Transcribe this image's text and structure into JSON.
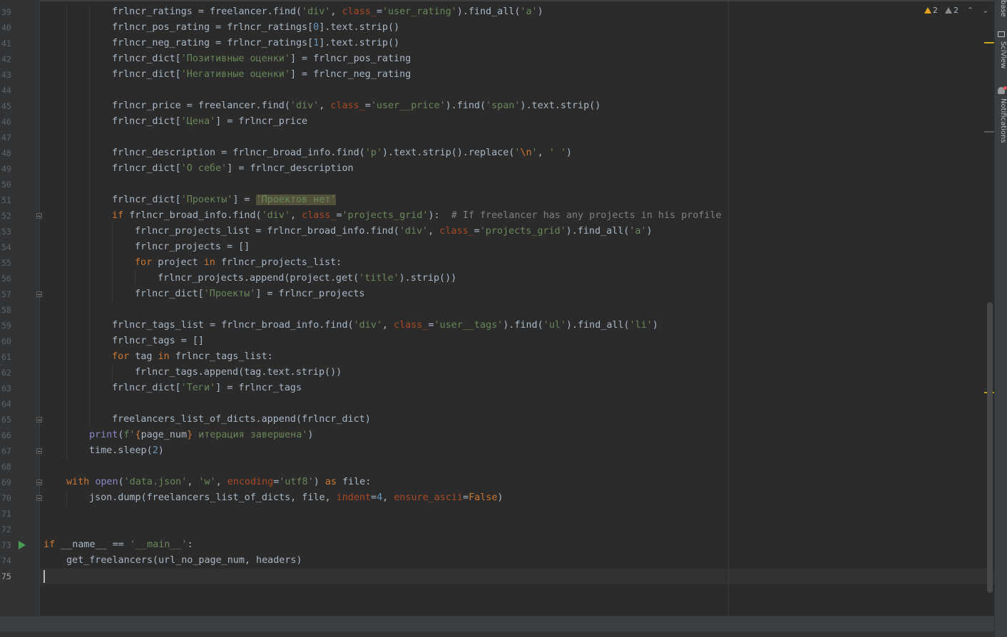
{
  "editor": {
    "inspections": {
      "warnings_count": "2",
      "weak_warnings_count": "2"
    },
    "lines": [
      {
        "n": "39",
        "indent": 3,
        "segs": [
          [
            "t",
            "frlncr_ratings = freelancer.find("
          ],
          [
            "s",
            "'div'"
          ],
          [
            "t",
            ", "
          ],
          [
            "a",
            "class_"
          ],
          [
            "t",
            "="
          ],
          [
            "s",
            "'user_rating'"
          ],
          [
            "t",
            ").find_all("
          ],
          [
            "s",
            "'a'"
          ],
          [
            "t",
            ")"
          ]
        ]
      },
      {
        "n": "40",
        "indent": 3,
        "segs": [
          [
            "t",
            "frlncr_pos_rating = frlncr_ratings["
          ],
          [
            "n",
            "0"
          ],
          [
            "t",
            "].text.strip()"
          ]
        ]
      },
      {
        "n": "41",
        "indent": 3,
        "segs": [
          [
            "t",
            "frlncr_neg_rating = frlncr_ratings["
          ],
          [
            "n",
            "1"
          ],
          [
            "t",
            "].text.strip()"
          ]
        ]
      },
      {
        "n": "42",
        "indent": 3,
        "segs": [
          [
            "t",
            "frlncr_dict["
          ],
          [
            "s",
            "'Позитивные оценки'"
          ],
          [
            "t",
            "] = frlncr_pos_rating"
          ]
        ]
      },
      {
        "n": "43",
        "indent": 3,
        "segs": [
          [
            "t",
            "frlncr_dict["
          ],
          [
            "s",
            "'Негативные оценки'"
          ],
          [
            "t",
            "] = frlncr_neg_rating"
          ]
        ]
      },
      {
        "n": "44",
        "indent": 3,
        "segs": []
      },
      {
        "n": "45",
        "indent": 3,
        "segs": [
          [
            "t",
            "frlncr_price = freelancer.find("
          ],
          [
            "s",
            "'div'"
          ],
          [
            "t",
            ", "
          ],
          [
            "a",
            "class_"
          ],
          [
            "t",
            "="
          ],
          [
            "s",
            "'user__price'"
          ],
          [
            "t",
            ").find("
          ],
          [
            "s",
            "'span'"
          ],
          [
            "t",
            ").text.strip()"
          ]
        ]
      },
      {
        "n": "46",
        "indent": 3,
        "segs": [
          [
            "t",
            "frlncr_dict["
          ],
          [
            "s",
            "'Цена'"
          ],
          [
            "t",
            "] = frlncr_price"
          ]
        ]
      },
      {
        "n": "47",
        "indent": 3,
        "segs": []
      },
      {
        "n": "48",
        "indent": 3,
        "segs": [
          [
            "t",
            "frlncr_description = frlncr_broad_info.find("
          ],
          [
            "s",
            "'p'"
          ],
          [
            "t",
            ").text.strip().replace("
          ],
          [
            "s",
            "'"
          ],
          [
            "k",
            "\\n"
          ],
          [
            "s",
            "'"
          ],
          [
            "t",
            ", "
          ],
          [
            "s",
            "' '"
          ],
          [
            "t",
            ")"
          ]
        ]
      },
      {
        "n": "49",
        "indent": 3,
        "segs": [
          [
            "t",
            "frlncr_dict["
          ],
          [
            "s",
            "'О себе'"
          ],
          [
            "t",
            "] = frlncr_description"
          ]
        ]
      },
      {
        "n": "50",
        "indent": 3,
        "segs": []
      },
      {
        "n": "51",
        "indent": 3,
        "segs": [
          [
            "t",
            "frlncr_dict["
          ],
          [
            "s",
            "'Проекты'"
          ],
          [
            "t",
            "] = "
          ],
          [
            "h",
            "'Проектов нет'"
          ]
        ]
      },
      {
        "n": "52",
        "indent": 3,
        "segs": [
          [
            "k",
            "if "
          ],
          [
            "t",
            "frlncr_broad_info.find("
          ],
          [
            "s",
            "'div'"
          ],
          [
            "t",
            ", "
          ],
          [
            "a",
            "class_"
          ],
          [
            "t",
            "="
          ],
          [
            "s",
            "'projects_grid'"
          ],
          [
            "t",
            "):  "
          ],
          [
            "c",
            "# If freelancer has any projects in his profile"
          ]
        ]
      },
      {
        "n": "53",
        "indent": 4,
        "segs": [
          [
            "t",
            "frlncr_projects_list = frlncr_broad_info.find("
          ],
          [
            "s",
            "'div'"
          ],
          [
            "t",
            ", "
          ],
          [
            "a",
            "class_"
          ],
          [
            "t",
            "="
          ],
          [
            "s",
            "'projects_grid'"
          ],
          [
            "t",
            ").find_all("
          ],
          [
            "s",
            "'a'"
          ],
          [
            "t",
            ")"
          ]
        ]
      },
      {
        "n": "54",
        "indent": 4,
        "segs": [
          [
            "t",
            "frlncr_projects = []"
          ]
        ]
      },
      {
        "n": "55",
        "indent": 4,
        "segs": [
          [
            "k",
            "for "
          ],
          [
            "t",
            "project "
          ],
          [
            "k",
            "in "
          ],
          [
            "t",
            "frlncr_projects_list:"
          ]
        ]
      },
      {
        "n": "56",
        "indent": 5,
        "segs": [
          [
            "t",
            "frlncr_projects.append(project.get("
          ],
          [
            "s",
            "'title'"
          ],
          [
            "t",
            ").strip())"
          ]
        ]
      },
      {
        "n": "57",
        "indent": 4,
        "segs": [
          [
            "t",
            "frlncr_dict["
          ],
          [
            "s",
            "'Проекты'"
          ],
          [
            "t",
            "] = frlncr_projects"
          ]
        ]
      },
      {
        "n": "58",
        "indent": 3,
        "segs": []
      },
      {
        "n": "59",
        "indent": 3,
        "segs": [
          [
            "t",
            "frlncr_tags_list = frlncr_broad_info.find("
          ],
          [
            "s",
            "'div'"
          ],
          [
            "t",
            ", "
          ],
          [
            "a",
            "class_"
          ],
          [
            "t",
            "="
          ],
          [
            "s",
            "'user__tags'"
          ],
          [
            "t",
            ").find("
          ],
          [
            "s",
            "'ul'"
          ],
          [
            "t",
            ").find_all("
          ],
          [
            "s",
            "'li'"
          ],
          [
            "t",
            ")"
          ]
        ]
      },
      {
        "n": "60",
        "indent": 3,
        "segs": [
          [
            "t",
            "frlncr_tags = []"
          ]
        ]
      },
      {
        "n": "61",
        "indent": 3,
        "segs": [
          [
            "k",
            "for "
          ],
          [
            "t",
            "tag "
          ],
          [
            "k",
            "in "
          ],
          [
            "t",
            "frlncr_tags_list:"
          ]
        ]
      },
      {
        "n": "62",
        "indent": 4,
        "segs": [
          [
            "t",
            "frlncr_tags.append(tag.text.strip())"
          ]
        ]
      },
      {
        "n": "63",
        "indent": 3,
        "segs": [
          [
            "t",
            "frlncr_dict["
          ],
          [
            "s",
            "'Теги'"
          ],
          [
            "t",
            "] = frlncr_tags"
          ]
        ]
      },
      {
        "n": "64",
        "indent": 3,
        "segs": []
      },
      {
        "n": "65",
        "indent": 3,
        "segs": [
          [
            "t",
            "freelancers_list_of_dicts.append(frlncr_dict)"
          ]
        ]
      },
      {
        "n": "66",
        "indent": 2,
        "segs": [
          [
            "b",
            "print"
          ],
          [
            "t",
            "("
          ],
          [
            "s",
            "f'"
          ],
          [
            "k",
            "{"
          ],
          [
            "t",
            "page_num"
          ],
          [
            "k",
            "}"
          ],
          [
            "s",
            " итерация завершена'"
          ],
          [
            "t",
            ")"
          ]
        ]
      },
      {
        "n": "67",
        "indent": 2,
        "segs": [
          [
            "t",
            "time.sleep("
          ],
          [
            "n",
            "2"
          ],
          [
            "t",
            ")"
          ]
        ]
      },
      {
        "n": "68",
        "indent": 1,
        "segs": []
      },
      {
        "n": "69",
        "indent": 1,
        "segs": [
          [
            "k",
            "with "
          ],
          [
            "b",
            "open"
          ],
          [
            "t",
            "("
          ],
          [
            "s",
            "'data.json'"
          ],
          [
            "t",
            ", "
          ],
          [
            "s",
            "'w'"
          ],
          [
            "t",
            ", "
          ],
          [
            "a",
            "encoding"
          ],
          [
            "t",
            "="
          ],
          [
            "s",
            "'utf8'"
          ],
          [
            "t",
            ") "
          ],
          [
            "k",
            "as "
          ],
          [
            "t",
            "file:"
          ]
        ]
      },
      {
        "n": "70",
        "indent": 2,
        "segs": [
          [
            "t",
            "json.dump(freelancers_list_of_dicts, file, "
          ],
          [
            "a",
            "indent"
          ],
          [
            "t",
            "="
          ],
          [
            "n",
            "4"
          ],
          [
            "t",
            ", "
          ],
          [
            "a",
            "ensure_ascii"
          ],
          [
            "t",
            "="
          ],
          [
            "k",
            "False"
          ],
          [
            "t",
            ")"
          ]
        ]
      },
      {
        "n": "71",
        "indent": 0,
        "segs": []
      },
      {
        "n": "72",
        "indent": 0,
        "segs": []
      },
      {
        "n": "73",
        "indent": 0,
        "segs": [
          [
            "k",
            "if "
          ],
          [
            "t",
            "__name__ == "
          ],
          [
            "s",
            "'__main__'"
          ],
          [
            "t",
            ":"
          ]
        ]
      },
      {
        "n": "74",
        "indent": 1,
        "segs": [
          [
            "t",
            "get_freelancers(url_no_page_num, headers)"
          ]
        ]
      },
      {
        "n": "75",
        "indent": 0,
        "segs": []
      }
    ]
  },
  "right_toolbar": {
    "items": [
      "base",
      "SciView",
      "Notifications"
    ]
  },
  "colors": {
    "keyword": "#cc7832",
    "string": "#6a8759",
    "number": "#6897bb",
    "builtin": "#8888c6",
    "kwarg": "#aa4926",
    "comment": "#808080",
    "text": "#a9b7c6",
    "warning": "#e0a31b",
    "run": "#499c54"
  }
}
